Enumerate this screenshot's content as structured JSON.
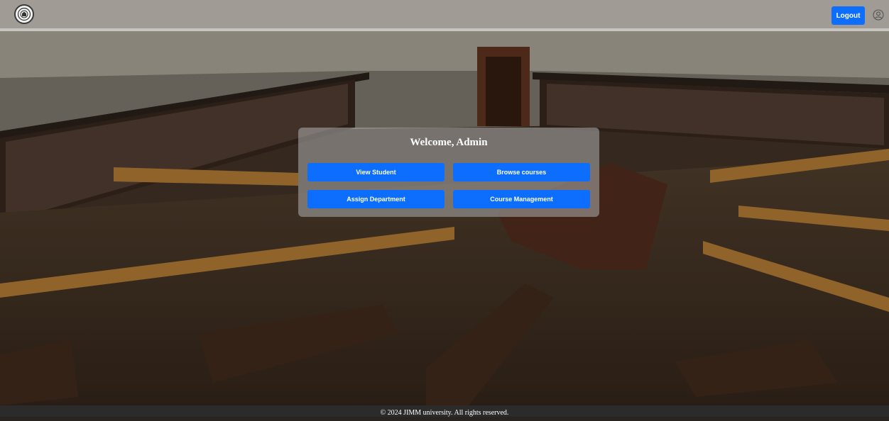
{
  "header": {
    "logo_icon": "university-seal-icon",
    "logout_label": "Logout",
    "user_icon": "user-circle-icon",
    "accent_color": "#0d6efd"
  },
  "welcome": {
    "title": "Welcome, Admin",
    "buttons": [
      {
        "label": "View Student"
      },
      {
        "label": "Browse courses"
      },
      {
        "label": "Assign Department"
      },
      {
        "label": "Course Management"
      }
    ]
  },
  "footer": {
    "text": "© 2024 JIMM university. All rights reserved."
  }
}
